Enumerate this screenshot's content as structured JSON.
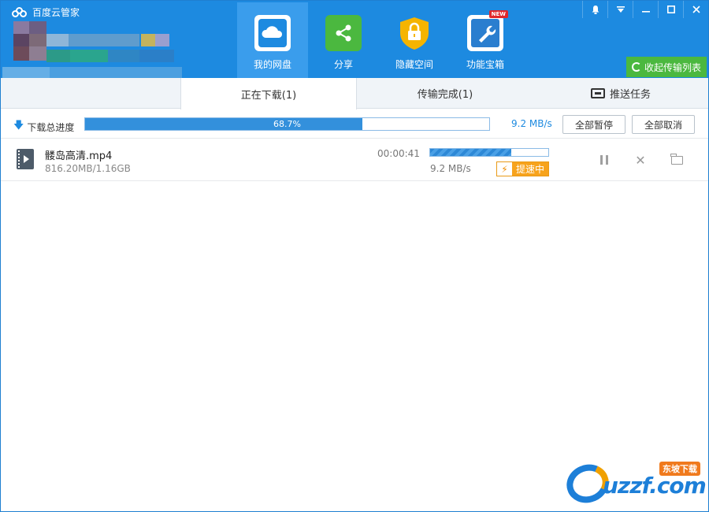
{
  "app": {
    "title": "百度云管家",
    "window_controls": [
      "bell-icon",
      "menu-icon",
      "minimize-icon",
      "maximize-icon",
      "close-icon"
    ]
  },
  "nav": {
    "items": [
      {
        "label": "我的网盘",
        "icon": "cloud-icon",
        "color": "#1d8ae0",
        "active": true
      },
      {
        "label": "分享",
        "icon": "share-icon",
        "color": "#4bb83f",
        "active": false
      },
      {
        "label": "隐藏空间",
        "icon": "lock-icon",
        "color": "#f0a500",
        "active": false
      },
      {
        "label": "功能宝箱",
        "icon": "wrench-icon",
        "color": "#1d8ae0",
        "active": false,
        "badge": "NEW"
      }
    ]
  },
  "collapse_button": {
    "label": "收起传输列表",
    "color": "#4bb83f"
  },
  "tabs": {
    "downloading": "正在下载(1)",
    "completed": "传输完成(1)",
    "push": "推送任务"
  },
  "total": {
    "label": "下载总进度",
    "progress": 0.687,
    "progress_text": "68.7%",
    "speed": "9.2 MB/s",
    "pause_all": "全部暂停",
    "cancel_all": "全部取消"
  },
  "files": [
    {
      "name": "髅岛高清.mp4",
      "size": "816.20MB/1.16GB",
      "time_left": "00:00:41",
      "progress": 0.687,
      "speed": "9.2 MB/s",
      "boost_label": "提速中"
    }
  ],
  "colors": {
    "accent": "#1d8ae0",
    "green": "#4bb83f",
    "boost": "#f7a31c"
  },
  "watermark": {
    "text": "uzzf.com",
    "tag": "东坡下载"
  }
}
